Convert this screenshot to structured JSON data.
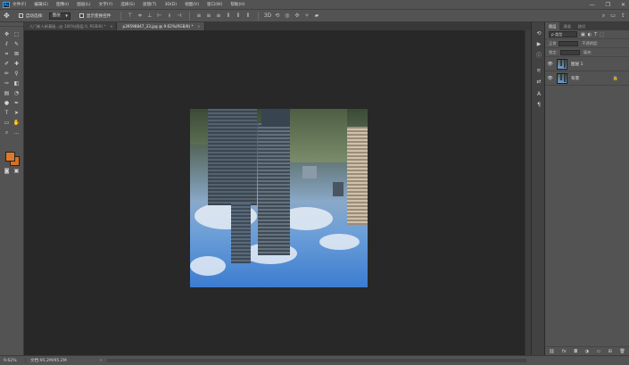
{
  "app": {
    "logo": "Ps",
    "window_controls": [
      "—",
      "❐",
      "✕"
    ]
  },
  "menu": [
    "文件(F)",
    "编辑(E)",
    "图像(I)",
    "图层(L)",
    "文字(Y)",
    "选择(S)",
    "滤镜(T)",
    "3D(D)",
    "视图(V)",
    "窗口(W)",
    "帮助(H)"
  ],
  "options": {
    "auto_select_label": "自动选择:",
    "auto_select_value": "图层",
    "show_transform_label": "显示变换控件"
  },
  "tabs": [
    {
      "label": "人门新人新基础...@ 100%(图层 0, RGB/8) *",
      "close": "×"
    },
    {
      "label": "p39598847_33.jpg @ 9.62%(RGB/8) *",
      "close": "×"
    }
  ],
  "status": {
    "zoom": "9.62%",
    "doc_info": "文档:95.2M/95.2M"
  },
  "layers_panel": {
    "tabs": [
      "图层",
      "通道",
      "路径"
    ],
    "filter_label": "ρ 类型",
    "mode_label": "正常",
    "opacity_label": "不透明度:",
    "lock_label": "锁定:",
    "fill_label": "填充:",
    "layers": [
      {
        "name": "图层 1",
        "visible": true,
        "locked": false
      },
      {
        "name": "背景",
        "visible": true,
        "locked": true
      }
    ]
  },
  "colors": {
    "foreground": "#e0782c",
    "background": "#d96f21",
    "ui_panel": "#535353",
    "canvas_bg": "#282828"
  }
}
